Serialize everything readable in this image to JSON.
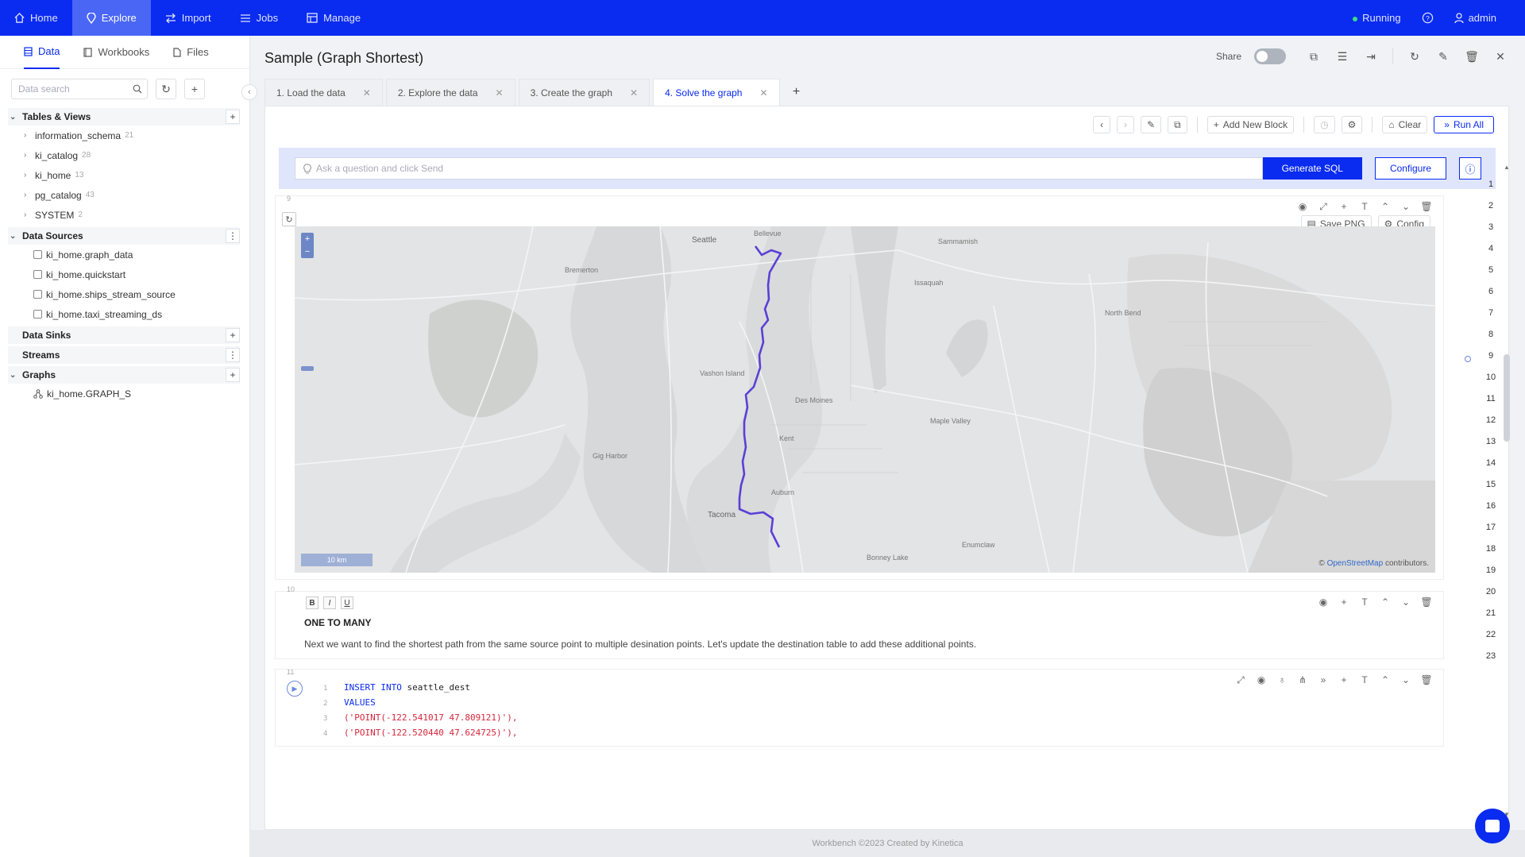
{
  "nav": {
    "items": [
      {
        "label": "Home",
        "icon": "home-icon"
      },
      {
        "label": "Explore",
        "icon": "explore-icon",
        "active": true
      },
      {
        "label": "Import",
        "icon": "import-icon"
      },
      {
        "label": "Jobs",
        "icon": "jobs-icon"
      },
      {
        "label": "Manage",
        "icon": "manage-icon"
      }
    ],
    "status": "Running",
    "user": "admin"
  },
  "sidebar": {
    "tabs": [
      {
        "label": "Data",
        "active": true
      },
      {
        "label": "Workbooks"
      },
      {
        "label": "Files"
      }
    ],
    "search_placeholder": "Data search",
    "tables_views": {
      "label": "Tables & Views",
      "items": [
        {
          "label": "information_schema",
          "count": "21"
        },
        {
          "label": "ki_catalog",
          "count": "28"
        },
        {
          "label": "ki_home",
          "count": "13"
        },
        {
          "label": "pg_catalog",
          "count": "43"
        },
        {
          "label": "SYSTEM",
          "count": "2"
        }
      ]
    },
    "data_sources": {
      "label": "Data Sources",
      "items": [
        "ki_home.graph_data",
        "ki_home.quickstart",
        "ki_home.ships_stream_source",
        "ki_home.taxi_streaming_ds"
      ]
    },
    "data_sinks": {
      "label": "Data Sinks"
    },
    "streams": {
      "label": "Streams"
    },
    "graphs": {
      "label": "Graphs",
      "items": [
        "ki_home.GRAPH_S"
      ]
    }
  },
  "workbook": {
    "title": "Sample (Graph Shortest)",
    "share_label": "Share",
    "tabs": [
      {
        "label": "1. Load the data"
      },
      {
        "label": "2. Explore the data"
      },
      {
        "label": "3. Create the graph"
      },
      {
        "label": "4. Solve the graph",
        "active": true
      }
    ],
    "toolbar": {
      "add_block": "Add New Block",
      "clear": "Clear",
      "run_all": "Run All"
    },
    "ask": {
      "placeholder": "Ask a question and click Send",
      "generate": "Generate SQL",
      "configure": "Configure"
    },
    "map_block": {
      "num": "9",
      "save_png": "Save PNG",
      "config": "Config",
      "scale": "10 km",
      "attribution_prefix": "©",
      "attribution_link": "OpenStreetMap",
      "attribution_suffix": "contributors.",
      "labels": {
        "seattle": "Seattle",
        "bellevue": "Bellevue",
        "bremerton": "Bremerton",
        "tacoma": "Tacoma",
        "sammamish": "Sammamish",
        "maple_valley": "Maple Valley",
        "des_moines": "Des Moines",
        "kent": "Kent",
        "auburn": "Auburn",
        "enumclaw": "Enumclaw",
        "gig_harbor": "Gig Harbor",
        "bonney_lake": "Bonney Lake",
        "issaquah": "Issaquah",
        "vashon_island": "Vashon Island",
        "north_bend": "North Bend"
      }
    },
    "md_block": {
      "num": "10",
      "bold": "B",
      "italic": "I",
      "underline": "U",
      "title": "ONE TO MANY",
      "text": "Next we want to find the shortest path from the same source point to multiple desination points. Let's update the destination table to add these additional points."
    },
    "sql_block": {
      "num": "11",
      "lines": [
        {
          "n": "1",
          "kw": "INSERT INTO",
          "plain": " seattle_dest",
          "str": ""
        },
        {
          "n": "2",
          "kw": "VALUES",
          "plain": "",
          "str": ""
        },
        {
          "n": "3",
          "kw": "",
          "plain": "",
          "str": "('POINT(-122.541017 47.809121)'),"
        },
        {
          "n": "4",
          "kw": "",
          "plain": "",
          "str": "('POINT(-122.520440 47.624725)'),"
        }
      ]
    },
    "gutter": [
      "1",
      "2",
      "3",
      "4",
      "5",
      "6",
      "7",
      "8",
      "9",
      "10",
      "11",
      "12",
      "13",
      "14",
      "15",
      "16",
      "17",
      "18",
      "19",
      "20",
      "21",
      "22",
      "23"
    ]
  },
  "footer": "Workbench ©2023 Created by Kinetica",
  "colors": {
    "brand": "#0a2bf0",
    "route": "#5b3fd6"
  }
}
